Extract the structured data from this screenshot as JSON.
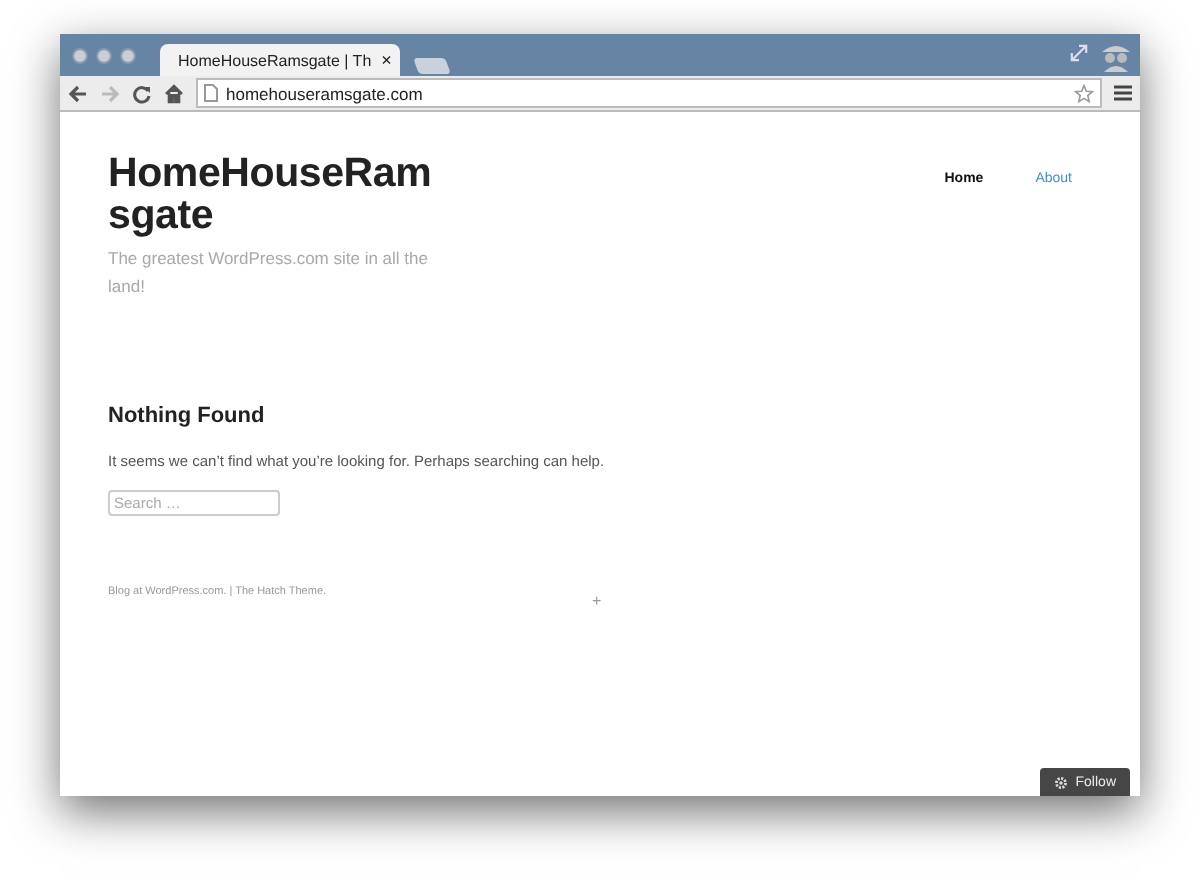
{
  "browser": {
    "tab_title": "HomeHouseRamsgate | Th",
    "close_tab": "×",
    "url": "homehouseramsgate.com"
  },
  "site": {
    "title": "HomeHouseRamsgate",
    "tagline": "The greatest WordPress.com site in all the land!",
    "nav": [
      {
        "label": "Home",
        "selected": true
      },
      {
        "label": "About",
        "selected": false
      }
    ],
    "heading": "Nothing Found",
    "message": "It seems we can’t find what you’re looking for. Perhaps searching can help.",
    "search": {
      "placeholder": "Search …"
    },
    "footer": "Blog at WordPress.com. | The Hatch Theme.",
    "plus": "+"
  },
  "follow_button": "Follow"
}
